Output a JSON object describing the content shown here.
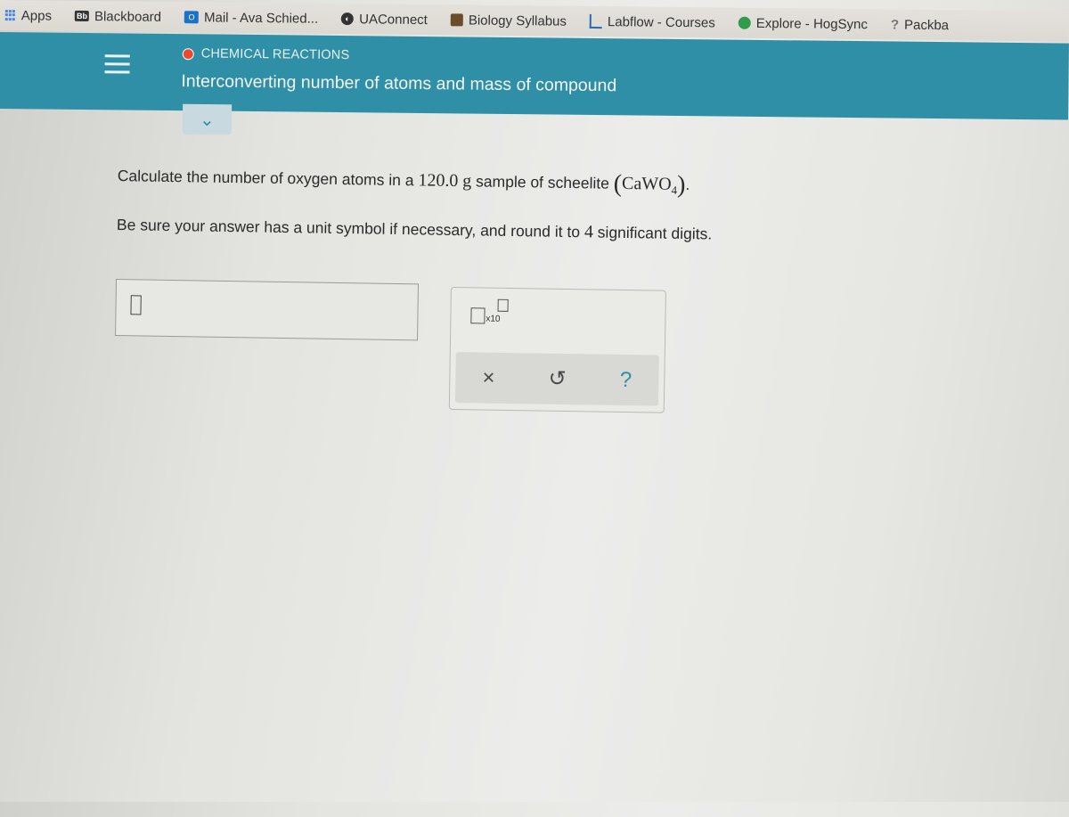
{
  "bookmarks": [
    {
      "label": "Apps",
      "icon": "apps-grid-icon"
    },
    {
      "label": "Blackboard",
      "icon": "blackboard-icon"
    },
    {
      "label": "Mail - Ava Schied...",
      "icon": "outlook-mail-icon"
    },
    {
      "label": "UAConnect",
      "icon": "uaconnect-icon"
    },
    {
      "label": "Biology Syllabus",
      "icon": "biology-syllabus-icon"
    },
    {
      "label": "Labflow - Courses",
      "icon": "labflow-icon"
    },
    {
      "label": "Explore - HogSync",
      "icon": "hogsync-icon"
    },
    {
      "label": "Packba",
      "icon": "packback-icon"
    }
  ],
  "header": {
    "topic": "CHEMICAL REACTIONS",
    "title": "Interconverting number of atoms and mass of compound",
    "menu_icon": "hamburger-menu-icon",
    "expand_icon": "chevron-down-icon"
  },
  "question": {
    "line1_pre": "Calculate the number of oxygen atoms in a ",
    "mass_value": "120.0",
    "mass_unit": "g",
    "line1_mid": " sample of scheelite ",
    "formula_main": "CaWO",
    "formula_sub": "4",
    "line1_post": ".",
    "line2_pre": "Be sure your answer has a unit symbol if necessary, and round it to ",
    "sig_figs": "4",
    "line2_post": " significant digits."
  },
  "answer": {
    "value": ""
  },
  "tools": {
    "sci_notation_label": "x10",
    "clear_icon": "×",
    "undo_icon": "↺",
    "help_icon": "?"
  },
  "colors": {
    "header_bg": "#2e8fa7",
    "topic_dot": "#e94b2e"
  }
}
